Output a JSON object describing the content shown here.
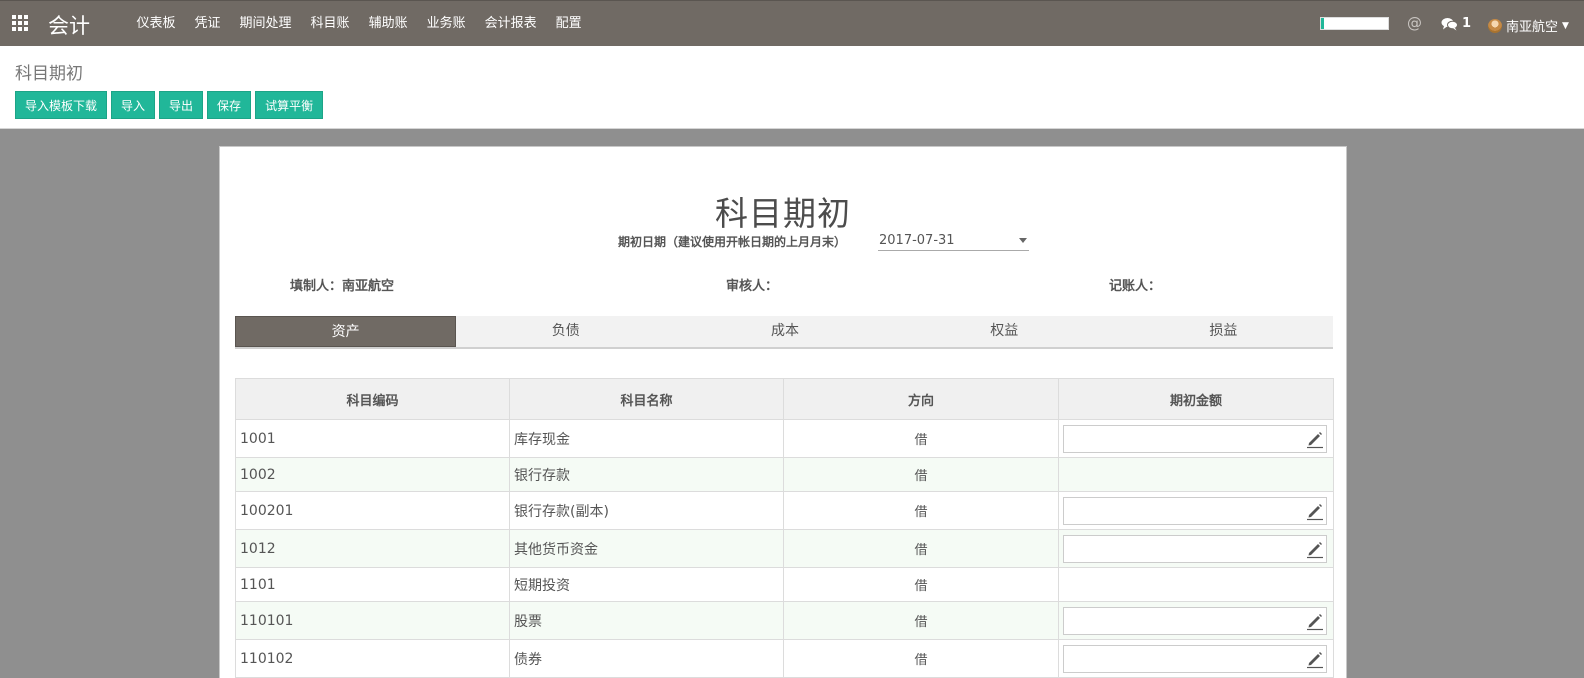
{
  "topbar": {
    "app_title": "会计",
    "menu": [
      "仪表板",
      "凭证",
      "期间处理",
      "科目账",
      "辅助账",
      "业务账",
      "会计报表",
      "配置"
    ],
    "progress": 0.05,
    "at_symbol": "@",
    "messages_count": "1",
    "user_name": "南亚航空"
  },
  "control": {
    "page_title": "科目期初",
    "buttons": [
      "导入模板下载",
      "导入",
      "导出",
      "保存",
      "试算平衡"
    ]
  },
  "sheet": {
    "title": "科目期初",
    "date_label": "期初日期（建议使用开帐日期的上月月末）",
    "date_value": "2017-07-31",
    "preparer": "填制人：南亚航空",
    "reviewer": "审核人：",
    "bookkeeper": "记账人："
  },
  "tabs": [
    "资产",
    "负债",
    "成本",
    "权益",
    "损益"
  ],
  "table": {
    "headers": [
      "科目编码",
      "科目名称",
      "方向",
      "期初金额"
    ],
    "rows": [
      {
        "code": "1001",
        "name": "库存现金",
        "dir": "借",
        "editable": true
      },
      {
        "code": "1002",
        "name": "银行存款",
        "dir": "借",
        "editable": false
      },
      {
        "code": "100201",
        "name": "银行存款(副本)",
        "dir": "借",
        "editable": true
      },
      {
        "code": "1012",
        "name": "其他货币资金",
        "dir": "借",
        "editable": true
      },
      {
        "code": "1101",
        "name": "短期投资",
        "dir": "借",
        "editable": false
      },
      {
        "code": "110101",
        "name": "股票",
        "dir": "借",
        "editable": true
      },
      {
        "code": "110102",
        "name": "债券",
        "dir": "借",
        "editable": true
      }
    ]
  },
  "colors": {
    "topbar": "#706a64",
    "accent": "#21b799"
  }
}
